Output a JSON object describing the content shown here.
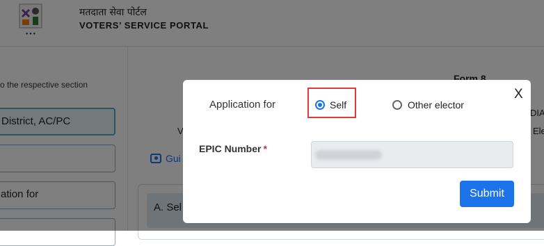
{
  "header": {
    "title_hindi": "मतदाता सेवा पोर्टल",
    "title_english": "VOTERS’ SERVICE PORTAL"
  },
  "left_panel": {
    "hint_text": "o the respective section",
    "buttons": [
      "District, AC/PC",
      "",
      "ation for",
      ""
    ]
  },
  "main": {
    "form_title": "Form 8",
    "frag_v": "V",
    "frag_dia": "DIA",
    "frag_ele": "Ele",
    "guide_link": "Gui",
    "card_heading": "A. Sel"
  },
  "modal": {
    "close_label": "X",
    "application_for_label": "Application for",
    "options": [
      {
        "label": "Self",
        "selected": true
      },
      {
        "label": "Other elector",
        "selected": false
      }
    ],
    "epic_label": "EPIC Number",
    "epic_required_mark": "*",
    "submit_label": "Submit"
  },
  "colors": {
    "accent": "#1a73e8",
    "highlight": "#e53935",
    "required": "#d32f2f"
  }
}
